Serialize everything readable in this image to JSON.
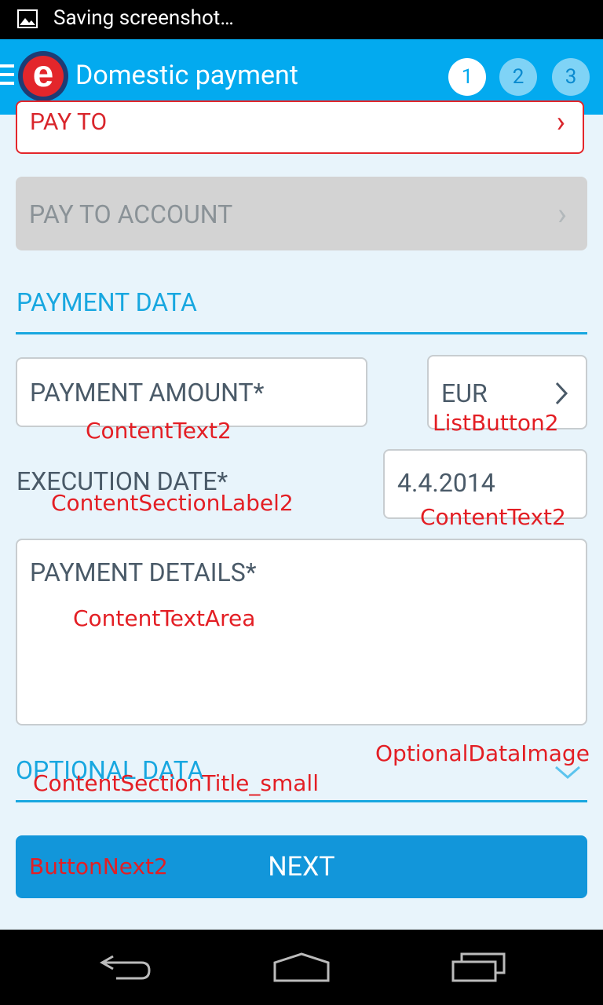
{
  "status_bar": {
    "icon": "image-icon",
    "text": "Saving screenshot…"
  },
  "action_bar": {
    "title": "Domestic payment",
    "steps": [
      "1",
      "2",
      "3"
    ],
    "active_step": "1",
    "colors": {
      "bar": "#03aaef",
      "logo_red": "#e3262b",
      "logo_blue": "#1e3c74"
    }
  },
  "pay_to": {
    "label": "PAY TO",
    "arrow": "›"
  },
  "pay_to_account": {
    "label": "PAY TO ACCOUNT",
    "arrow": "›"
  },
  "payment_data": {
    "title": "PAYMENT DATA",
    "amount": {
      "placeholder": "PAYMENT AMOUNT*",
      "annotation": "ContentText2"
    },
    "currency": {
      "value": "EUR",
      "arrow": "›",
      "annotation": "ListButton2"
    },
    "execution_date": {
      "label": "EXECUTION DATE*",
      "label_annotation": "ContentSectionLabel2",
      "value": "4.4.2014",
      "value_annotation": "ContentText2"
    },
    "details": {
      "placeholder": "PAYMENT DETAILS*",
      "annotation": "ContentTextArea"
    }
  },
  "optional_data": {
    "title": "OPTIONAL DATA",
    "title_annotation": "ContentSectionTitle_small",
    "image_annotation": "OptionalDataImage"
  },
  "next_button": {
    "label": "NEXT",
    "annotation": "ButtonNext2"
  },
  "nav_bar": {
    "items": [
      "back-icon",
      "home-icon",
      "recents-icon"
    ]
  }
}
